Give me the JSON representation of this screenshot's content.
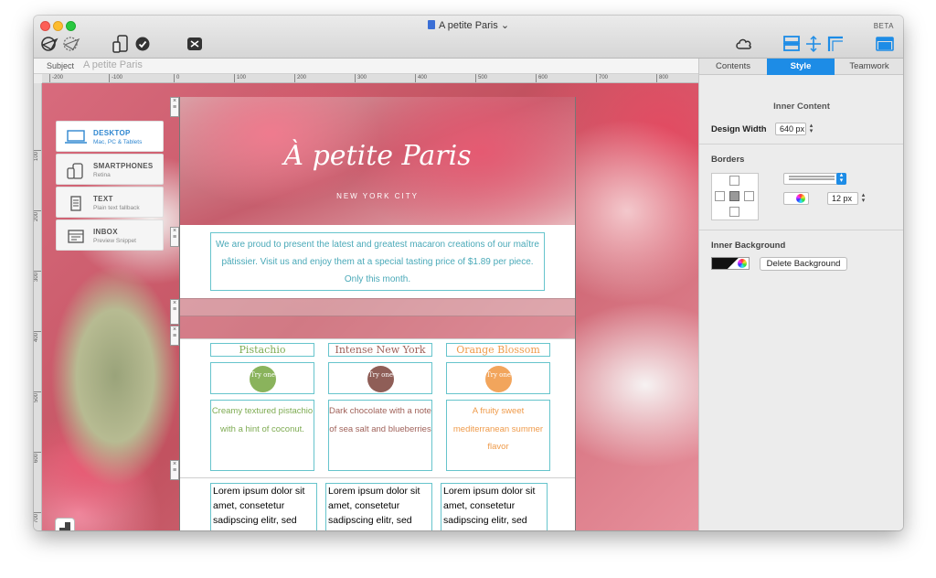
{
  "window": {
    "title": "A petite Paris",
    "beta": "BETA"
  },
  "subject": {
    "label": "Subject",
    "value": "A petite Paris"
  },
  "ruler": {
    "h": [
      "-200",
      "-100",
      "0",
      "100",
      "200",
      "300",
      "400",
      "500",
      "600",
      "700",
      "800"
    ],
    "v": [
      "100",
      "200",
      "300",
      "400",
      "500",
      "600",
      "700"
    ]
  },
  "devices": [
    {
      "name": "DESKTOP",
      "sub": "Mac, PC & Tablets",
      "icon": "laptop-icon"
    },
    {
      "name": "SMARTPHONES",
      "sub": "Retina",
      "icon": "smartphone-icon"
    },
    {
      "name": "TEXT",
      "sub": "Plain text fallback",
      "icon": "document-icon"
    },
    {
      "name": "INBOX",
      "sub": "Preview Snippet",
      "icon": "inbox-icon"
    }
  ],
  "email": {
    "logo": "À petite Paris",
    "tagline": "NEW YORK CITY",
    "intro": "We are proud to present the latest and greatest macaron creations of our maître pâtissier. Visit us and enjoy them at a special tasting price of $1.89 per piece. Only this month.",
    "flavors": [
      {
        "name": "Pistachio",
        "try": "Try one",
        "desc": "Creamy textured pistachio with a hint of coconut.",
        "color": "#7eab52",
        "circle": "#8ab35c"
      },
      {
        "name": "Intense New York",
        "try": "Try one",
        "desc": "Dark chocolate with a note of sea salt and blueberries",
        "color": "#a0625a",
        "circle": "#8f5e57"
      },
      {
        "name": "Orange Blossom",
        "try": "Try one",
        "desc": "A fruity sweet mediterranean summer flavor",
        "color": "#ef9b4b",
        "circle": "#f2a55c"
      }
    ],
    "lorem": "Lorem ipsum dolor sit amet, consetetur sadipscing elitr, sed diam nonumy eirmod tempor invidunt ut"
  },
  "inspector": {
    "tabs": [
      "Contents",
      "Style",
      "Teamwork"
    ],
    "active_tab": "Style",
    "inner_content_heading": "Inner Content",
    "design_width_label": "Design Width",
    "design_width_value": "640 px",
    "borders_heading": "Borders",
    "border_width_value": "12 px",
    "inner_background_heading": "Inner Background",
    "delete_background_label": "Delete Background"
  },
  "colors": {
    "accent": "#1d8ce6",
    "teal_text": "#4aa9b8",
    "teal_border": "#66c4cc"
  }
}
